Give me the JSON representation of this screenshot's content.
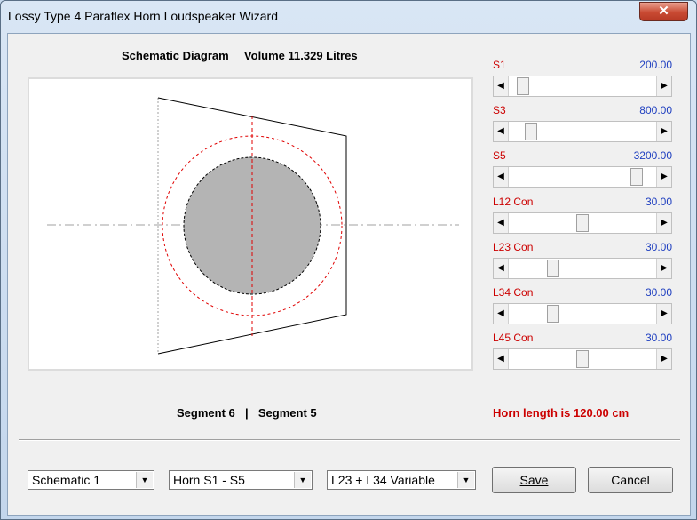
{
  "window": {
    "title": "Lossy Type 4 Paraflex Horn Loudspeaker Wizard",
    "close_glyph": "✕"
  },
  "diagram": {
    "label": "Schematic Diagram",
    "volume": "Volume 11.329 Litres"
  },
  "segments": {
    "left": "Segment 6",
    "divider": "|",
    "right": "Segment 5"
  },
  "horn_length": "Horn length is 120.00 cm",
  "sliders": [
    {
      "label": "S1",
      "value": "200.00",
      "position": 0.06
    },
    {
      "label": "S3",
      "value": "800.00",
      "position": 0.12
    },
    {
      "label": "S5",
      "value": "3200.00",
      "position": 0.9
    },
    {
      "label": "L12  Con",
      "value": "30.00",
      "position": 0.5
    },
    {
      "label": "L23  Con",
      "value": "30.00",
      "position": 0.28
    },
    {
      "label": "L34  Con",
      "value": "30.00",
      "position": 0.28
    },
    {
      "label": "L45  Con",
      "value": "30.00",
      "position": 0.5
    }
  ],
  "combos": {
    "schematic": "Schematic 1",
    "horn": "Horn S1 - S5",
    "variable": "L23 + L34 Variable"
  },
  "buttons": {
    "save": "Save",
    "cancel": "Cancel"
  },
  "glyphs": {
    "left": "◀",
    "right": "▶",
    "down": "▼"
  },
  "icons": [
    "close-icon",
    "left-arrow-icon",
    "right-arrow-icon",
    "dropdown-arrow-icon"
  ]
}
